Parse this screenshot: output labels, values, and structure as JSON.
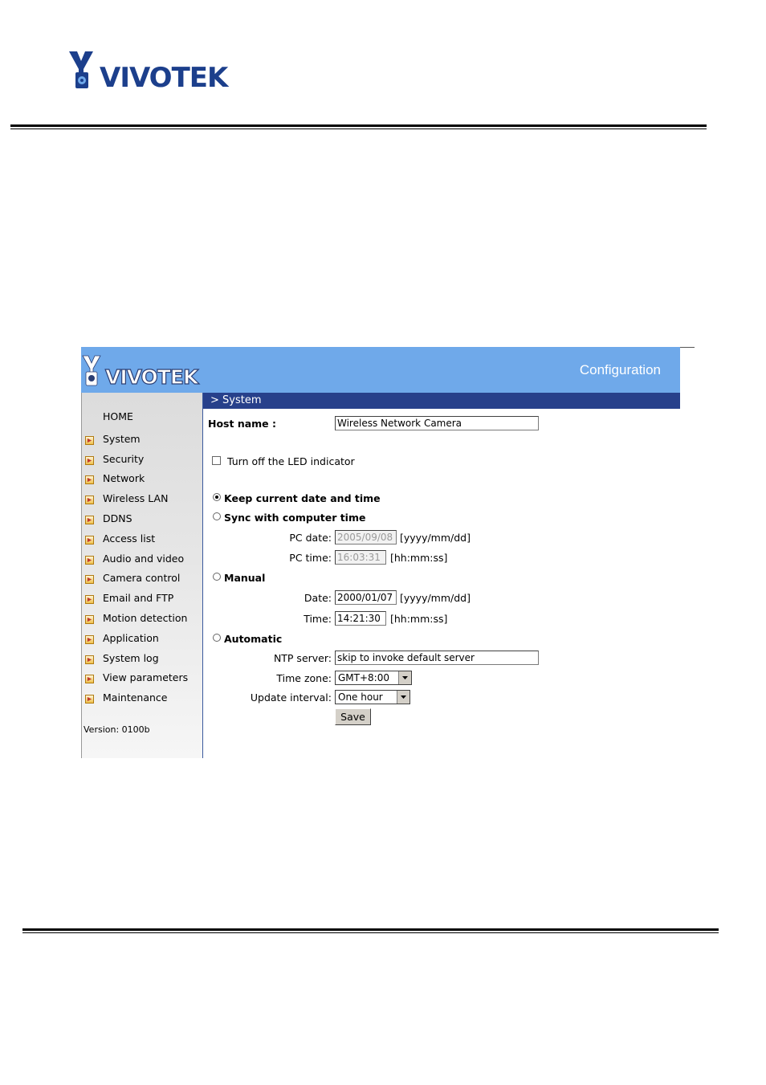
{
  "brand": {
    "name": "VIVOTEK"
  },
  "header": {
    "section": "Configuration"
  },
  "sidebar": {
    "home": "HOME",
    "items": [
      {
        "label": "System"
      },
      {
        "label": "Security"
      },
      {
        "label": "Network"
      },
      {
        "label": "Wireless LAN"
      },
      {
        "label": "DDNS"
      },
      {
        "label": "Access list"
      },
      {
        "label": "Audio and video"
      },
      {
        "label": "Camera control"
      },
      {
        "label": "Email and FTP"
      },
      {
        "label": "Motion detection"
      },
      {
        "label": "Application"
      },
      {
        "label": "System log"
      },
      {
        "label": "View parameters"
      },
      {
        "label": "Maintenance"
      }
    ],
    "version": "Version: 0100b"
  },
  "page": {
    "title": "> System",
    "host_name_label": "Host name :",
    "host_name_value": "Wireless Network Camera",
    "led_label": "Turn off the LED indicator",
    "led_checked": false,
    "keep_label": "Keep current date and time",
    "sync_label": "Sync with computer time",
    "pc_date_label": "PC date:",
    "pc_date_value": "2005/09/08",
    "pc_date_format": "[yyyy/mm/dd]",
    "pc_time_label": "PC time:",
    "pc_time_value": "16:03:31",
    "pc_time_format": "[hh:mm:ss]",
    "manual_label": "Manual",
    "date_label": "Date:",
    "date_value": "2000/01/07",
    "date_format": "[yyyy/mm/dd]",
    "time_label": "Time:",
    "time_value": "14:21:30",
    "time_format": "[hh:mm:ss]",
    "automatic_label": "Automatic",
    "ntp_label": "NTP server:",
    "ntp_value": "skip to invoke default server",
    "timezone_label": "Time zone:",
    "timezone_value": "GMT+8:00",
    "interval_label": "Update interval:",
    "interval_value": "One hour",
    "save_label": "Save",
    "selected_mode": "keep"
  },
  "colors": {
    "header_bg": "#6fa9ea",
    "titlebar_bg": "#27408b"
  }
}
